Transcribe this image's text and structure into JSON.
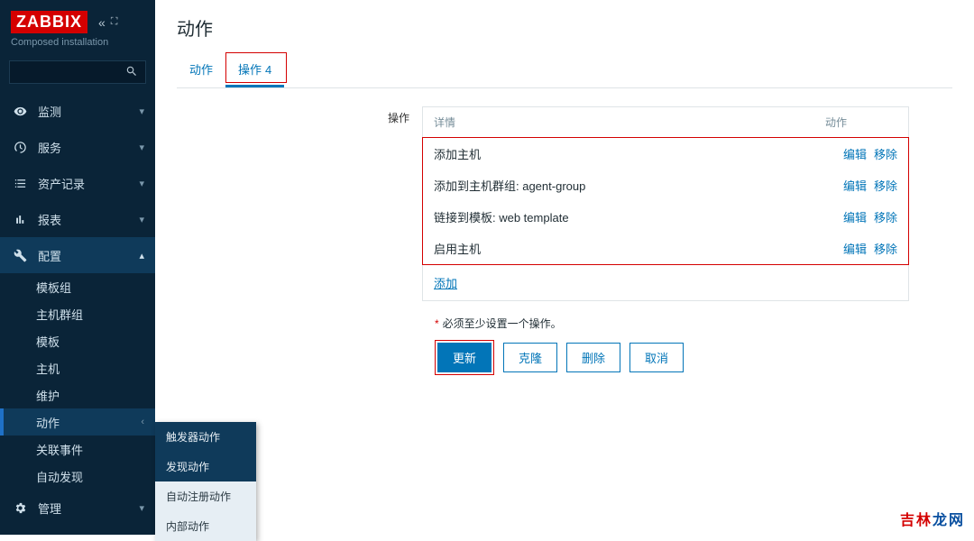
{
  "brand": {
    "logo": "ZABBIX",
    "subtitle": "Composed installation"
  },
  "sidebar": {
    "items": [
      {
        "label": "监测"
      },
      {
        "label": "服务"
      },
      {
        "label": "资产记录"
      },
      {
        "label": "报表"
      },
      {
        "label": "配置"
      },
      {
        "label": "管理"
      }
    ],
    "config_sub": [
      {
        "label": "模板组"
      },
      {
        "label": "主机群组"
      },
      {
        "label": "模板"
      },
      {
        "label": "主机"
      },
      {
        "label": "维护"
      },
      {
        "label": "动作"
      },
      {
        "label": "关联事件"
      },
      {
        "label": "自动发现"
      }
    ],
    "flyout": [
      {
        "label": "触发器动作"
      },
      {
        "label": "发现动作"
      },
      {
        "label": "自动注册动作"
      },
      {
        "label": "内部动作"
      }
    ]
  },
  "page": {
    "title": "动作"
  },
  "tabs": [
    {
      "label": "动作"
    },
    {
      "label": "操作",
      "count": "4"
    }
  ],
  "form": {
    "ops_label": "操作",
    "headers": {
      "details": "详情",
      "actions": "动作"
    },
    "rows": [
      {
        "detail": "添加主机"
      },
      {
        "detail": "添加到主机群组: agent-group"
      },
      {
        "detail": "链接到模板: web template"
      },
      {
        "detail": "启用主机"
      }
    ],
    "edit": "编辑",
    "remove": "移除",
    "add": "添加",
    "required_note": "必须至少设置一个操作。",
    "buttons": {
      "update": "更新",
      "clone": "克隆",
      "delete": "删除",
      "cancel": "取消"
    }
  },
  "watermark": {
    "a": "吉林",
    "b": "龙网"
  }
}
